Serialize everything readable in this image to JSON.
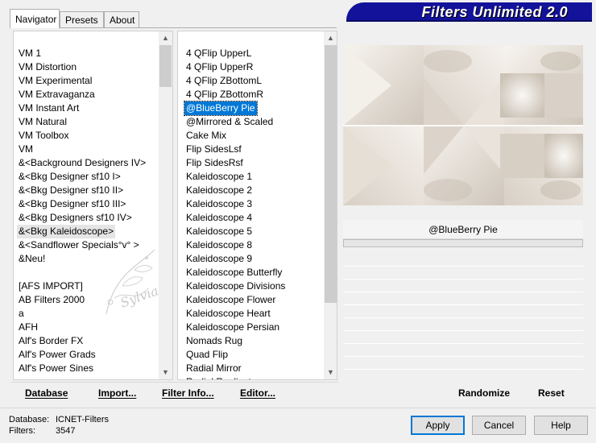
{
  "tabs": [
    {
      "label": "Navigator",
      "active": true
    },
    {
      "label": "Presets",
      "active": false
    },
    {
      "label": "About",
      "active": false
    }
  ],
  "banner": {
    "title": "Filters Unlimited 2.0",
    "color": "#13129a"
  },
  "categories": {
    "items": [
      "VM 1",
      "VM Distortion",
      "VM Experimental",
      "VM Extravaganza",
      "VM Instant Art",
      "VM Natural",
      "VM Toolbox",
      "VM",
      "&<Background Designers IV>",
      "&<Bkg Designer sf10 I>",
      "&<Bkg Designer sf10 II>",
      "&<Bkg Designer sf10 III>",
      "&<Bkg Designers sf10 IV>",
      "&<Bkg Kaleidoscope>",
      "&<Sandflower Specials°v° >",
      "&Neu!",
      "",
      "[AFS IMPORT]",
      "AB Filters 2000",
      "a",
      "AFH",
      "Alf's Border FX",
      "Alf's Power Grads",
      "Alf's Power Sines"
    ],
    "selected": "&<Bkg Kaleidoscope>"
  },
  "filters": {
    "items": [
      "4 QFlip UpperL",
      "4 QFlip UpperR",
      "4 QFlip ZBottomL",
      "4 QFlip ZBottomR",
      "@BlueBerry Pie",
      "@Mirrored & Scaled",
      "Cake Mix",
      "Flip SidesLsf",
      "Flip SidesRsf",
      "Kaleidoscope 1",
      "Kaleidoscope 2",
      "Kaleidoscope 3",
      "Kaleidoscope 4",
      "Kaleidoscope 5",
      "Kaleidoscope 8",
      "Kaleidoscope 9",
      "Kaleidoscope Butterfly",
      "Kaleidoscope Divisions",
      "Kaleidoscope Flower",
      "Kaleidoscope Heart",
      "Kaleidoscope Persian",
      "Nomads Rug",
      "Quad Flip",
      "Radial Mirror",
      "Radial Replicate"
    ],
    "selected": "@BlueBerry Pie"
  },
  "preview": {
    "filter_name": "@BlueBerry Pie",
    "watermark": "Sylvia"
  },
  "toolbar": {
    "database": "Database",
    "import": "Import...",
    "filter_info": "Filter Info...",
    "editor": "Editor...",
    "randomize": "Randomize",
    "reset": "Reset"
  },
  "status": {
    "database_label": "Database:",
    "database_value": "ICNET-Filters",
    "filters_label": "Filters:",
    "filters_value": "3547"
  },
  "buttons": {
    "apply": "Apply",
    "cancel": "Cancel",
    "help": "Help"
  },
  "colors": {
    "selection": "#0078d7",
    "banner": "#13129a"
  }
}
